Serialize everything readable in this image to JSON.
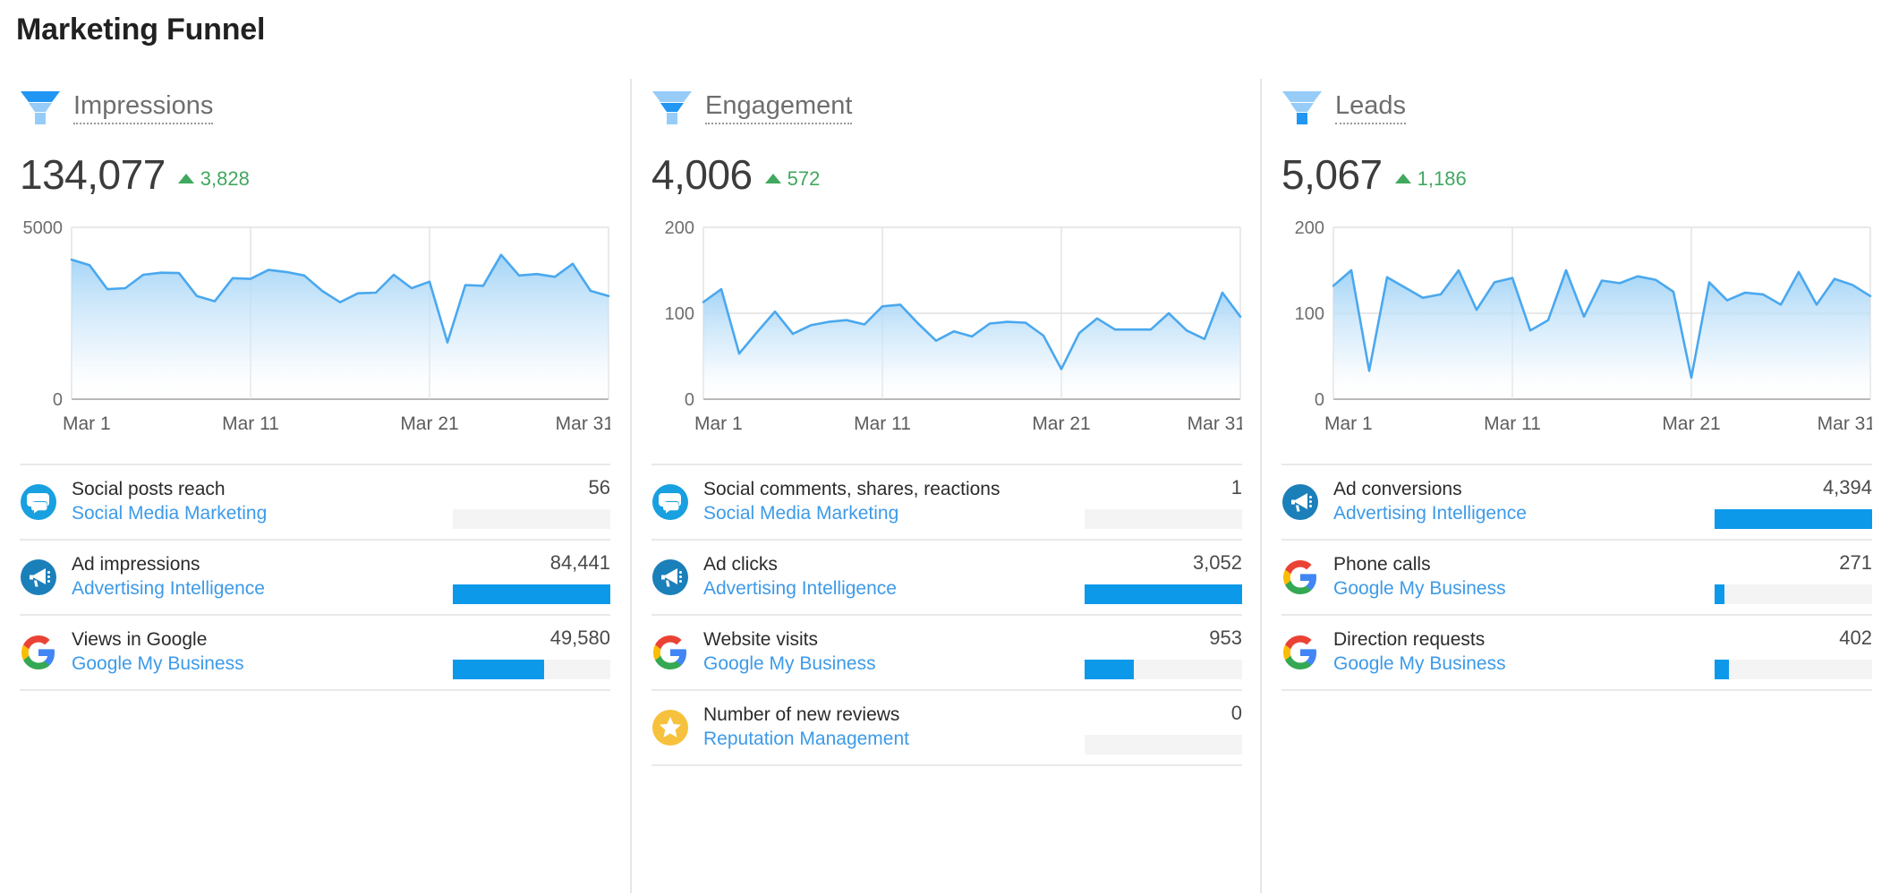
{
  "page": {
    "title": "Marketing Funnel"
  },
  "theme": {
    "accent_blue": "#0d99ea",
    "link_blue": "#3d9ae8",
    "funnel_dark": "#2196f3",
    "funnel_light": "#96ccf7",
    "delta_green": "#41a85f",
    "bar_track": "#f4f4f4",
    "text_dark": "#2b2b2b",
    "text_muted": "#6e6e6e",
    "divider": "#e9e9e9"
  },
  "cards": [
    {
      "id": "impressions",
      "icon": "funnel-top-icon",
      "title": "Impressions",
      "value": "134,077",
      "delta": "3,828",
      "delta_direction": "up",
      "chart": {
        "y_ticks": [
          "5000",
          "0"
        ],
        "x_ticks": [
          "Mar 1",
          "Mar 11",
          "Mar 21",
          "Mar 31"
        ]
      },
      "rows": [
        {
          "icon": "social-bubble-icon",
          "name": "Social posts reach",
          "source": "Social Media Marketing",
          "value": "56",
          "bar_pct": 0
        },
        {
          "icon": "megaphone-icon",
          "name": "Ad impressions",
          "source": "Advertising Intelligence",
          "value": "84,441",
          "bar_pct": 100
        },
        {
          "icon": "google-g-icon",
          "name": "Views in Google",
          "source": "Google My Business",
          "value": "49,580",
          "bar_pct": 58
        }
      ]
    },
    {
      "id": "engagement",
      "icon": "funnel-middle-icon",
      "title": "Engagement",
      "value": "4,006",
      "delta": "572",
      "delta_direction": "up",
      "chart": {
        "y_ticks": [
          "200",
          "100",
          "0"
        ],
        "x_ticks": [
          "Mar 1",
          "Mar 11",
          "Mar 21",
          "Mar 31"
        ]
      },
      "rows": [
        {
          "icon": "social-bubble-icon",
          "name": "Social comments, shares, reactions",
          "source": "Social Media Marketing",
          "value": "1",
          "bar_pct": 0
        },
        {
          "icon": "megaphone-icon",
          "name": "Ad clicks",
          "source": "Advertising Intelligence",
          "value": "3,052",
          "bar_pct": 100
        },
        {
          "icon": "google-g-icon",
          "name": "Website visits",
          "source": "Google My Business",
          "value": "953",
          "bar_pct": 31
        },
        {
          "icon": "star-badge-icon",
          "name": "Number of new reviews",
          "source": "Reputation Management",
          "value": "0",
          "bar_pct": 0
        }
      ]
    },
    {
      "id": "leads",
      "icon": "funnel-bottom-icon",
      "title": "Leads",
      "value": "5,067",
      "delta": "1,186",
      "delta_direction": "up",
      "chart": {
        "y_ticks": [
          "200",
          "100",
          "0"
        ],
        "x_ticks": [
          "Mar 1",
          "Mar 11",
          "Mar 21",
          "Mar 31"
        ]
      },
      "rows": [
        {
          "icon": "megaphone-icon",
          "name": "Ad conversions",
          "source": "Advertising Intelligence",
          "value": "4,394",
          "bar_pct": 100
        },
        {
          "icon": "google-g-icon",
          "name": "Phone calls",
          "source": "Google My Business",
          "value": "271",
          "bar_pct": 6
        },
        {
          "icon": "google-g-icon",
          "name": "Direction requests",
          "source": "Google My Business",
          "value": "402",
          "bar_pct": 9
        }
      ]
    }
  ],
  "chart_data": [
    {
      "type": "area",
      "title": "Impressions",
      "xlabel": "",
      "ylabel": "",
      "ylim": [
        0,
        5000
      ],
      "grid": true,
      "legend": "none",
      "x": [
        "Mar 1",
        "Mar 2",
        "Mar 3",
        "Mar 4",
        "Mar 5",
        "Mar 6",
        "Mar 7",
        "Mar 8",
        "Mar 9",
        "Mar 10",
        "Mar 11",
        "Mar 12",
        "Mar 13",
        "Mar 14",
        "Mar 15",
        "Mar 16",
        "Mar 17",
        "Mar 18",
        "Mar 19",
        "Mar 20",
        "Mar 21",
        "Mar 22",
        "Mar 23",
        "Mar 24",
        "Mar 25",
        "Mar 26",
        "Mar 27",
        "Mar 28",
        "Mar 29",
        "Mar 30",
        "Mar 31"
      ],
      "y_tick_values": [
        0,
        5000
      ],
      "x_tick_labels": [
        "Mar 1",
        "Mar 11",
        "Mar 21",
        "Mar 31"
      ],
      "values": [
        4060,
        3900,
        3200,
        3230,
        3620,
        3680,
        3670,
        3000,
        2850,
        3520,
        3500,
        3760,
        3700,
        3600,
        3150,
        2820,
        3080,
        3100,
        3620,
        3230,
        3420,
        1650,
        3320,
        3300,
        4200,
        3600,
        3640,
        3560,
        3940,
        3150,
        3000
      ]
    },
    {
      "type": "area",
      "title": "Engagement",
      "xlabel": "",
      "ylabel": "",
      "ylim": [
        0,
        200
      ],
      "grid": true,
      "legend": "none",
      "x": [
        "Mar 1",
        "Mar 2",
        "Mar 3",
        "Mar 4",
        "Mar 5",
        "Mar 6",
        "Mar 7",
        "Mar 8",
        "Mar 9",
        "Mar 10",
        "Mar 11",
        "Mar 12",
        "Mar 13",
        "Mar 14",
        "Mar 15",
        "Mar 16",
        "Mar 17",
        "Mar 18",
        "Mar 19",
        "Mar 20",
        "Mar 21",
        "Mar 22",
        "Mar 23",
        "Mar 24",
        "Mar 25",
        "Mar 26",
        "Mar 27",
        "Mar 28",
        "Mar 29",
        "Mar 30",
        "Mar 31"
      ],
      "y_tick_values": [
        0,
        100,
        200
      ],
      "x_tick_labels": [
        "Mar 1",
        "Mar 11",
        "Mar 21",
        "Mar 31"
      ],
      "values": [
        113,
        128,
        53,
        78,
        102,
        76,
        86,
        90,
        92,
        87,
        108,
        110,
        88,
        68,
        79,
        73,
        88,
        90,
        89,
        74,
        35,
        77,
        94,
        81,
        81,
        81,
        100,
        80,
        70,
        124,
        96
      ]
    },
    {
      "type": "area",
      "title": "Leads",
      "xlabel": "",
      "ylabel": "",
      "ylim": [
        0,
        200
      ],
      "grid": true,
      "legend": "none",
      "x": [
        "Mar 1",
        "Mar 2",
        "Mar 3",
        "Mar 4",
        "Mar 5",
        "Mar 6",
        "Mar 7",
        "Mar 8",
        "Mar 9",
        "Mar 10",
        "Mar 11",
        "Mar 12",
        "Mar 13",
        "Mar 14",
        "Mar 15",
        "Mar 16",
        "Mar 17",
        "Mar 18",
        "Mar 19",
        "Mar 20",
        "Mar 21",
        "Mar 22",
        "Mar 23",
        "Mar 24",
        "Mar 25",
        "Mar 26",
        "Mar 27",
        "Mar 28",
        "Mar 29",
        "Mar 30",
        "Mar 31"
      ],
      "y_tick_values": [
        0,
        100,
        200
      ],
      "x_tick_labels": [
        "Mar 1",
        "Mar 11",
        "Mar 21",
        "Mar 31"
      ],
      "values": [
        132,
        150,
        33,
        142,
        130,
        118,
        122,
        150,
        104,
        136,
        141,
        80,
        92,
        150,
        96,
        138,
        135,
        143,
        139,
        125,
        25,
        136,
        115,
        124,
        122,
        110,
        148,
        110,
        140,
        133,
        120
      ]
    }
  ]
}
